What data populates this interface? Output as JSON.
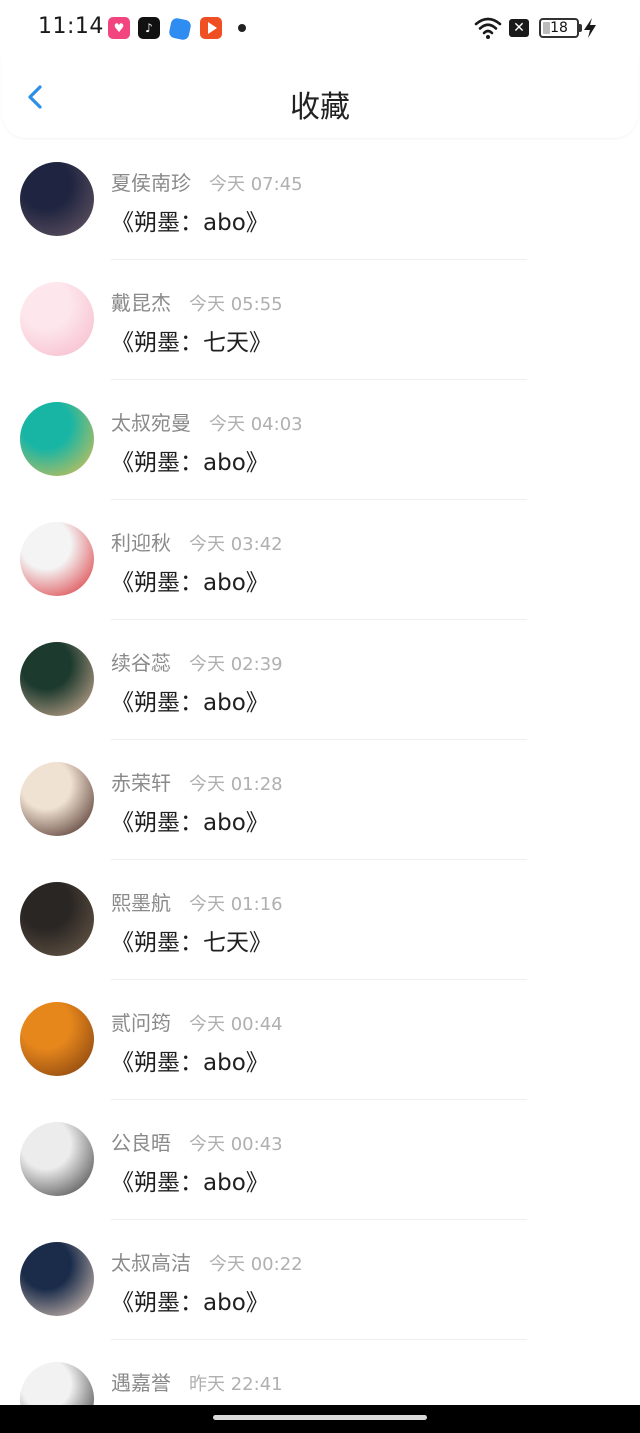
{
  "status_bar": {
    "time": "11:14",
    "battery_level": "18",
    "icons": [
      "lofter-app-icon",
      "tiktok-app-icon",
      "blue-app-icon",
      "video-app-icon",
      "notification-dot",
      "wifi-icon",
      "close-icon",
      "battery-icon",
      "charging-bolt-icon"
    ]
  },
  "header": {
    "title": "收藏",
    "back_icon": "chevron-left-icon",
    "accent_color": "#2b8ee8"
  },
  "items": [
    {
      "name": "夏侯南珍",
      "time": "今天 07:45",
      "title": "《朔墨：abo》",
      "avatar_colors": [
        "#1f2440",
        "#6b5a66"
      ]
    },
    {
      "name": "戴昆杰",
      "time": "今天 05:55",
      "title": "《朔墨：七天》",
      "avatar_colors": [
        "#fde6ec",
        "#f6b7c9"
      ]
    },
    {
      "name": "太叔宛曼",
      "time": "今天 04:03",
      "title": "《朔墨：abo》",
      "avatar_colors": [
        "#18b5a5",
        "#e8c04a"
      ]
    },
    {
      "name": "利迎秋",
      "time": "今天 03:42",
      "title": "《朔墨：abo》",
      "avatar_colors": [
        "#f4f4f4",
        "#d8262c"
      ]
    },
    {
      "name": "续谷蕊",
      "time": "今天 02:39",
      "title": "《朔墨：abo》",
      "avatar_colors": [
        "#1c3a2e",
        "#d9b49a"
      ]
    },
    {
      "name": "赤荣轩",
      "time": "今天 01:28",
      "title": "《朔墨：abo》",
      "avatar_colors": [
        "#f0e2d2",
        "#3a1a14"
      ]
    },
    {
      "name": "熙墨航",
      "time": "今天 01:16",
      "title": "《朔墨：七天》",
      "avatar_colors": [
        "#2a2624",
        "#6e5d4a"
      ]
    },
    {
      "name": "贰问筠",
      "time": "今天 00:44",
      "title": "《朔墨：abo》",
      "avatar_colors": [
        "#e6871c",
        "#7a3a0e"
      ]
    },
    {
      "name": "公良晤",
      "time": "今天 00:43",
      "title": "《朔墨：abo》",
      "avatar_colors": [
        "#ececec",
        "#333333"
      ]
    },
    {
      "name": "太叔高洁",
      "time": "今天 00:22",
      "title": "《朔墨：abo》",
      "avatar_colors": [
        "#1a2c4a",
        "#e8d0c0"
      ]
    },
    {
      "name": "遇嘉誉",
      "time": "昨天 22:41",
      "title": "",
      "avatar_colors": [
        "#f2f2f2",
        "#222222"
      ]
    }
  ]
}
